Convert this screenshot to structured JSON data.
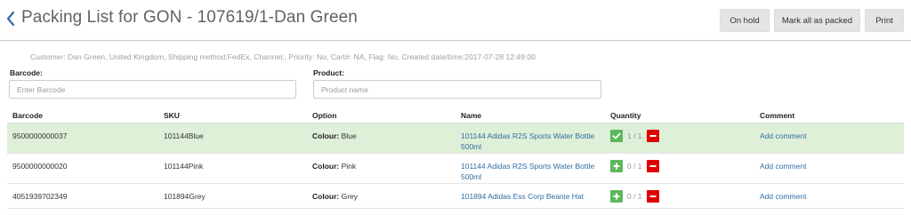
{
  "header": {
    "title": "Packing List for GON - 107619/1-Dan Green",
    "buttons": {
      "on_hold": "On hold",
      "mark_all_packed": "Mark all as packed",
      "print": "Print"
    }
  },
  "order_info": "Customer: Dan Green, United Kingdom, Shipping method:FedEx, Channel:, Priority: No, Cart#: NA, Flag: No, Created date/time:2017-07-28 12:49:00",
  "filters": {
    "barcode": {
      "label": "Barcode:",
      "placeholder": "Enter Barcode"
    },
    "product": {
      "label": "Product:",
      "placeholder": "Product name"
    }
  },
  "table": {
    "columns": [
      "Barcode",
      "SKU",
      "Option",
      "Name",
      "Quantity",
      "Comment"
    ],
    "rows": [
      {
        "barcode": "9500000000037",
        "sku": "101144Blue",
        "option_label": "Colour:",
        "option_value": " Blue",
        "name": "101144 Adidas R2S Sports Water Bottle 500ml",
        "quantity": "1 / 1",
        "packed": true,
        "comment": "Add comment"
      },
      {
        "barcode": "9500000000020",
        "sku": "101144Pink",
        "option_label": "Colour:",
        "option_value": " Pink",
        "name": "101144 Adidas R2S Sports Water Bottle 500ml",
        "quantity": "0 / 1",
        "packed": false,
        "comment": "Add comment"
      },
      {
        "barcode": "4051939702349",
        "sku": "101894Grey",
        "option_label": "Colour:",
        "option_value": " Grey",
        "name": "101894 Adidas Ess Corp Beanie Hat",
        "quantity": "0 / 1",
        "packed": false,
        "comment": "Add comment"
      }
    ]
  },
  "icons": {
    "back": "chevron-left-icon",
    "packed": "check-icon",
    "increment": "plus-icon",
    "decrement": "minus-icon"
  },
  "colors": {
    "accent": "#2e6da4",
    "packed_row": "#dff0d8",
    "success": "#5cb85c",
    "danger": "#e00000"
  }
}
